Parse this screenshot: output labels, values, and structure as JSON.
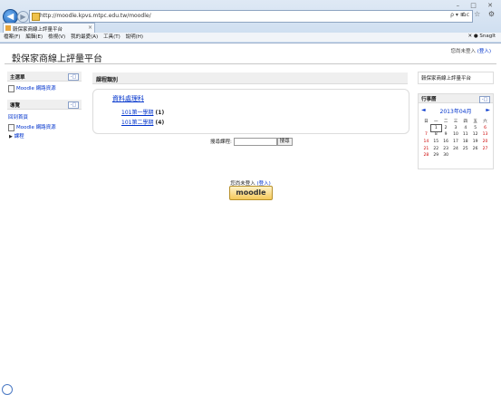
{
  "browser": {
    "url": "http://moodle.kpvs.mtpc.edu.tw/moodle/",
    "tab_title": "穀保家商線上評量平台",
    "menu": [
      "檔案(F)",
      "編輯(E)",
      "檢視(V)",
      "我的最愛(A)",
      "工具(T)",
      "說明(H)"
    ],
    "snagit_label": "SnagIt",
    "address_tools": "ρ ▾ ≣ c",
    "window_buttons": "– □ ✕",
    "right_icons": "⌂ ☆ ⚙"
  },
  "header": {
    "site_title": "穀保家商線上評量平台",
    "login_status": "您尚未登入",
    "login_link": "(登入)"
  },
  "main_menu": {
    "title": "主選單",
    "items": [
      "Moodle 網路資源"
    ]
  },
  "navigation": {
    "title": "導覽",
    "items": [
      "回到首頁",
      "Moodle 網路資源",
      "課程"
    ]
  },
  "course_categories": {
    "title": "課程類別",
    "category": "資料處理科",
    "subcategories": [
      {
        "name": "101第一學期",
        "count": "(1)"
      },
      {
        "name": "101第二學期",
        "count": "(4)"
      }
    ]
  },
  "search": {
    "label": "搜尋課程:",
    "button": "搜尋"
  },
  "site_description": "穀保家商線上評量平台",
  "calendar": {
    "title": "行事曆",
    "month": "2013年04月",
    "prev": "◄",
    "next": "►",
    "weekdays": [
      "日",
      "一",
      "二",
      "三",
      "四",
      "五",
      "六"
    ],
    "weeks": [
      [
        "",
        "1",
        "2",
        "3",
        "4",
        "5",
        "6"
      ],
      [
        "7",
        "8",
        "9",
        "10",
        "11",
        "12",
        "13"
      ],
      [
        "14",
        "15",
        "16",
        "17",
        "18",
        "19",
        "20"
      ],
      [
        "21",
        "22",
        "23",
        "24",
        "25",
        "26",
        "27"
      ],
      [
        "28",
        "29",
        "30",
        "",
        "",
        "",
        ""
      ]
    ],
    "today": "1"
  },
  "footer": {
    "login_status": "您尚未登入",
    "login_link": "(登入)",
    "logo_text": "moodle"
  }
}
